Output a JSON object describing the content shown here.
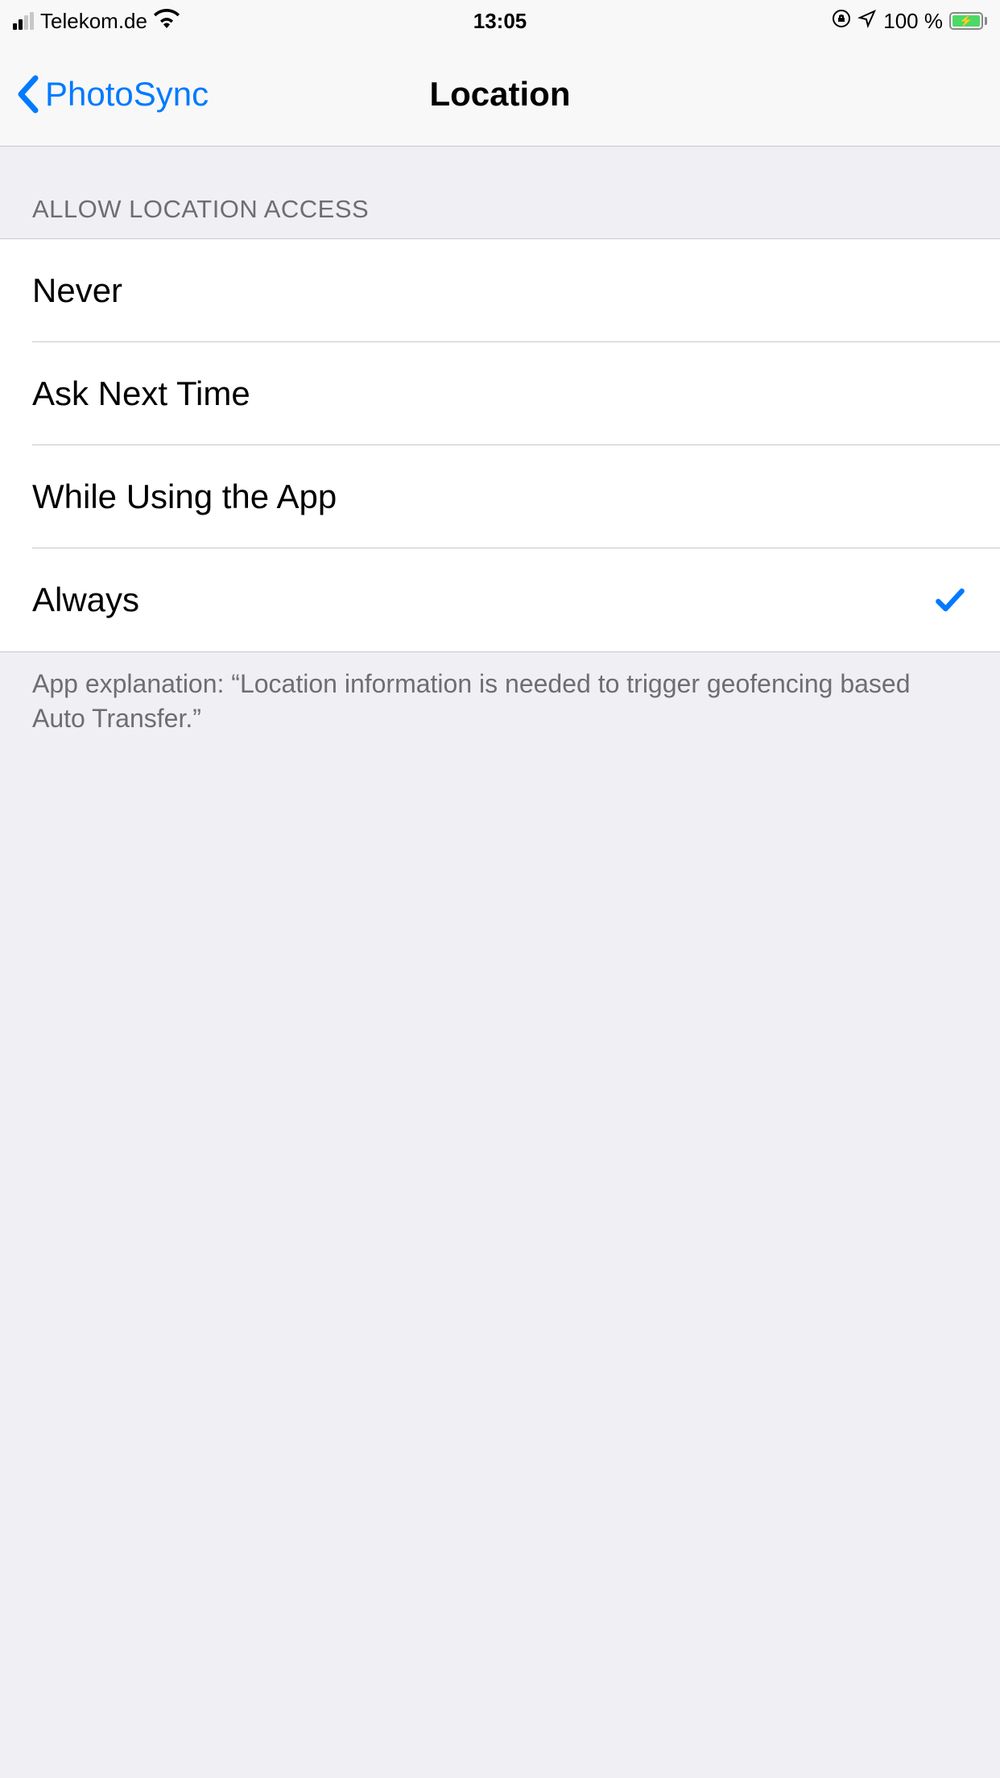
{
  "statusBar": {
    "carrier": "Telekom.de",
    "time": "13:05",
    "battery": "100 %"
  },
  "navBar": {
    "back": "PhotoSync",
    "title": "Location"
  },
  "section": {
    "header": "Allow Location Access",
    "footer": "App explanation: “Location information is needed to trigger geofencing based Auto Transfer.”"
  },
  "options": [
    {
      "label": "Never",
      "selected": false
    },
    {
      "label": "Ask Next Time",
      "selected": false
    },
    {
      "label": "While Using the App",
      "selected": false
    },
    {
      "label": "Always",
      "selected": true
    }
  ]
}
